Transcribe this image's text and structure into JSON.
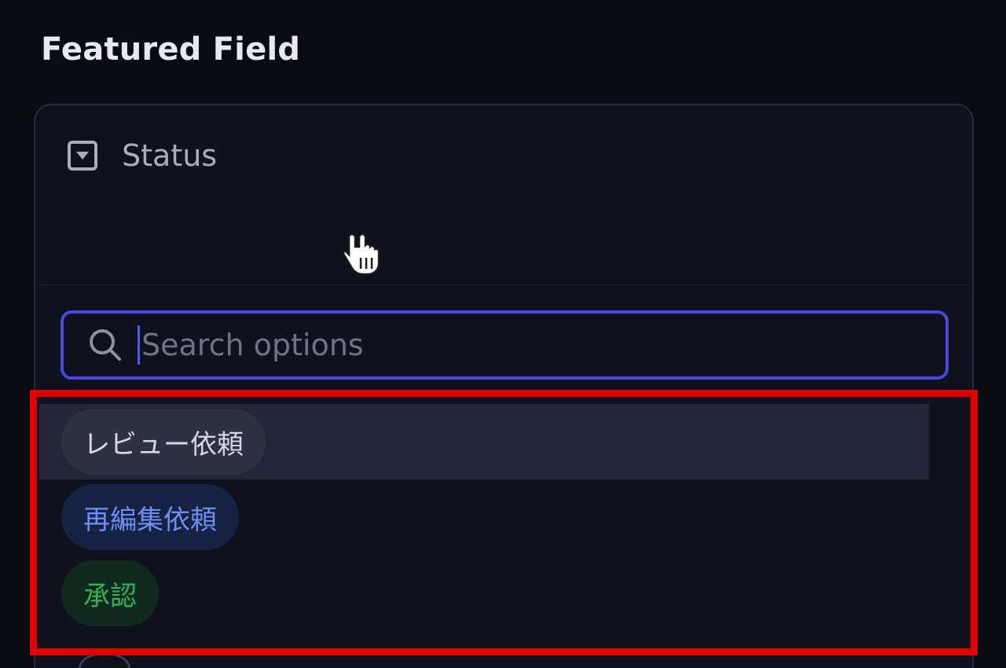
{
  "section": {
    "title": "Featured Field"
  },
  "field": {
    "icon": "select-dropdown-icon",
    "label": "Status"
  },
  "search": {
    "placeholder": "Search options",
    "value": "",
    "icon": "search-icon"
  },
  "options": [
    {
      "label": "レビュー依頼",
      "color": "#d6d8e2",
      "background": "#2e3143",
      "hovered": true
    },
    {
      "label": "再編集依頼",
      "color": "#6f8ff0",
      "background": "#172143",
      "hovered": false
    },
    {
      "label": "承認",
      "color": "#2fb35a",
      "background": "#102a1e",
      "hovered": false
    }
  ],
  "colors": {
    "accent": "#4b45e3",
    "highlight_box": "#e00000",
    "background": "#0a0b12"
  }
}
